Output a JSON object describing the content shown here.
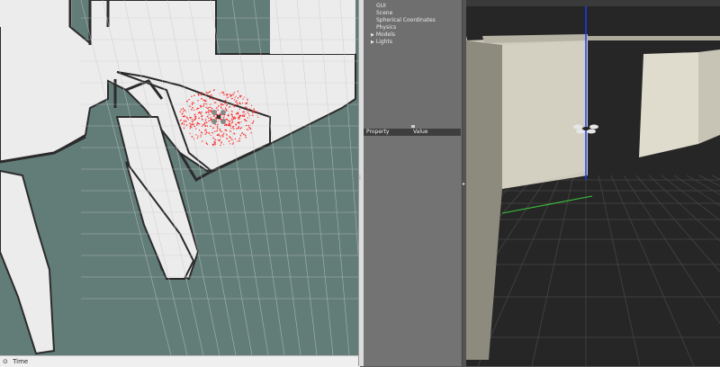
{
  "rviz": {
    "status_label": "Time",
    "colors": {
      "background": "#627d78",
      "free_space": "#ececec",
      "wall": "#2b2b2b",
      "particles": "#ff1a1a",
      "grid": "#c8c8c8"
    }
  },
  "gazebo": {
    "world_tree": {
      "items": [
        {
          "label": "GUI",
          "expandable": false
        },
        {
          "label": "Scene",
          "expandable": false
        },
        {
          "label": "Spherical Coordinates",
          "expandable": false
        },
        {
          "label": "Physics",
          "expandable": false
        },
        {
          "label": "Models",
          "expandable": true
        },
        {
          "label": "Lights",
          "expandable": true
        }
      ]
    },
    "properties": {
      "column_property": "Property",
      "column_value": "Value"
    },
    "colors": {
      "panel": "#6f6f6f",
      "viewport": "#262626",
      "walls": "#d9d5c6",
      "z_axis": "#1a3cff",
      "y_axis": "#3cc83c"
    }
  }
}
